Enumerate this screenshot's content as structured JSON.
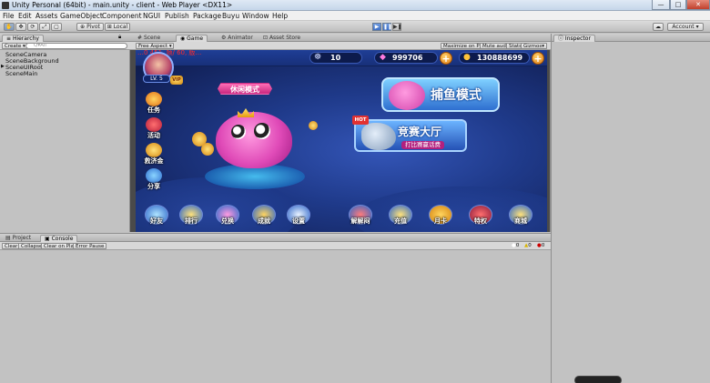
{
  "window": {
    "title": "Unity Personal (64bit) - main.unity - client - Web Player <DX11>",
    "min": "—",
    "max": "□",
    "close": "✕"
  },
  "menu": [
    "File",
    "Edit",
    "Assets",
    "GameObject",
    "Component",
    "NGUI",
    "Publish",
    "Package",
    "Buyu",
    "Window",
    "Help"
  ],
  "toolbar": {
    "pivot": "Pivot",
    "local": "Local",
    "layers": "Layers",
    "account": "Account",
    "play": "▶",
    "pause": "❚❚",
    "step": "▶❚"
  },
  "hierarchy": {
    "tab": "Hierarchy",
    "create": "Create",
    "search_placeholder": "Q▾All",
    "items": [
      "SceneCamera",
      "SceneBackground",
      "SceneUIRoot",
      "SceneMain"
    ]
  },
  "game_panel": {
    "tabs": [
      "Scene",
      "Game",
      "Animator",
      "Asset Store"
    ],
    "aspect": "Free Aspect",
    "options": [
      "Maximize on Play",
      "Mute audio",
      "Stats",
      "Gizmos"
    ]
  },
  "inspector": {
    "tab": "Inspector"
  },
  "console": {
    "tabs": [
      "Project",
      "Console"
    ],
    "buttons": [
      "Clear",
      "Collapse",
      "Clear on Play",
      "Error Pause"
    ],
    "counts": [
      "0",
      "0",
      "0"
    ]
  },
  "game": {
    "overlay_text": "…0 451, 帧/ 60, 版…",
    "player_level": "LV. 5",
    "vip": "VIP",
    "res_count": "10",
    "gems": "999706",
    "gold": "130888699",
    "plus": "+",
    "leisure_mode": "休闲模式",
    "catch_mode": "捕鱼模式",
    "competition_hall": "竞赛大厅",
    "competition_sub": "打比赛赢话费",
    "hot": "HOT",
    "side_buttons": [
      "任务",
      "活动",
      "救济金",
      "分享"
    ],
    "bottom_left": [
      "好友",
      "排行",
      "兑换",
      "成就",
      "设置"
    ],
    "bottom_right": [
      "解解闷",
      "充值",
      "月卡",
      "特权",
      "商城"
    ]
  },
  "colors": {
    "unity_bg": "#c2c2c2",
    "game_bg": "#1f3a8a",
    "gold": "#f5b321",
    "pink_fish": "#e04bb8"
  }
}
